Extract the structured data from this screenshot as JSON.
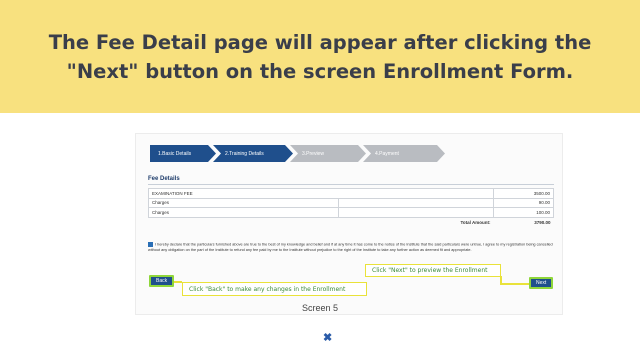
{
  "banner": {
    "title": "The Fee Detail page will appear after clicking the \"Next\" button on the screen Enrollment Form."
  },
  "screenshot": {
    "steps": [
      {
        "label": "1.Basic Details",
        "state": "active"
      },
      {
        "label": "2.Training Details",
        "state": "active"
      },
      {
        "label": "3.Preview",
        "state": "inactive"
      },
      {
        "label": "4.Payment",
        "state": "inactive"
      }
    ],
    "fee_section_title": "Fee Details",
    "fee_rows": [
      {
        "name": "EXAMINATION FEE",
        "amount": "3500.00"
      },
      {
        "name": "Charges",
        "amount": "90.00"
      },
      {
        "name": "Charges",
        "amount": "100.00"
      }
    ],
    "total_label": "Total Amount:",
    "total_value": "3790.00",
    "declaration": "I hereby declare that the particulars furnished above are true to the best of my knowledge and belief and if at any time it has come to the notice of the Institute that the said particulars were untrue, I agree to my registration being cancelled without any obligation on the part of the Institute to refund any fee paid by me to the Institute without prejudice to the right of the Institute to take any further action as deemed fit and appropriate.",
    "back_button": "Back",
    "next_button": "Next",
    "callout_next": "Click \"Next\" to preview the Enrollment",
    "callout_back": "Click \"Back\" to make any changes in the Enrollment"
  },
  "caption": "Screen 5",
  "colors": {
    "banner_bg": "#f8e17f",
    "step_active": "#1f4f8c",
    "step_inactive": "#b9bcc1",
    "callout_border": "#e9e23a",
    "callout_text": "#3a8a3a",
    "button_highlight": "#8fd63a"
  },
  "icons": {
    "close": "close-icon"
  }
}
